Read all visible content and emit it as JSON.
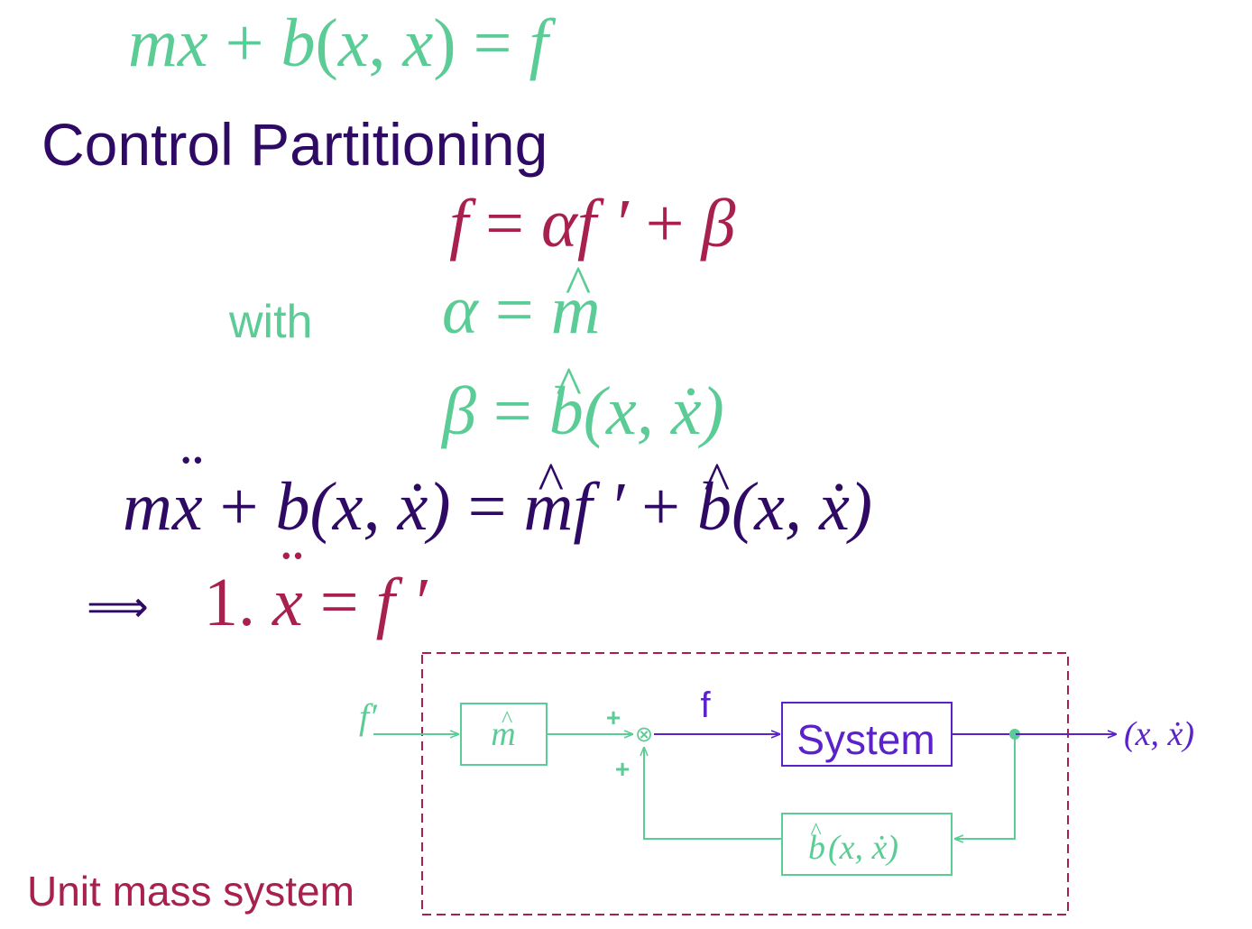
{
  "equations": {
    "top": {
      "m": "m",
      "x_ddot": "x",
      "plus": "+",
      "b": "b",
      "lparen": "(",
      "x": "x",
      "comma": ",",
      "x_dot": "x",
      "rparen": ")",
      "equals": "=",
      "f": "f"
    },
    "f_def": {
      "f": "f",
      "equals": "=",
      "alpha": "α",
      "f_prime": "f ′",
      "plus": "+",
      "beta": "β"
    },
    "alpha_def": {
      "alpha": "α",
      "equals": "=",
      "m_hat": "m"
    },
    "beta_def": {
      "beta": "β",
      "equals": "=",
      "b_hat": "b",
      "args": "(x, ẋ)"
    },
    "main": {
      "lhs_m": "m",
      "lhs_x_ddot": "x",
      "plus1": "+",
      "lhs_b": "b",
      "lhs_args": "(x, ẋ)",
      "equals": "=",
      "m_hat": "m",
      "f_prime": "f ′",
      "plus2": "+",
      "b_hat": "b",
      "rhs_args": "(x, ẋ)"
    },
    "result": {
      "number": "1.",
      "x_ddot": "x",
      "equals": "=",
      "f_prime": "f ′"
    }
  },
  "labels": {
    "title": "Control Partitioning",
    "with": "with",
    "implies": "⟹",
    "unit_mass": "Unit mass system"
  },
  "diagram": {
    "input_label": "f′",
    "m_hat_block": "m",
    "sum_plus_top": "+",
    "sum_plus_bottom": "+",
    "sum_symbol": "⊗",
    "signal_f": "f",
    "system_block": "System",
    "output_label": "(x, ẋ)",
    "b_hat_block": "b",
    "b_hat_args": "(x, ẋ)"
  },
  "colors": {
    "green": "#5ccc96",
    "crimson": "#a8204e",
    "indigo": "#2e0a64",
    "purple": "#5a22c8",
    "dashed_box": "#a8204e"
  }
}
